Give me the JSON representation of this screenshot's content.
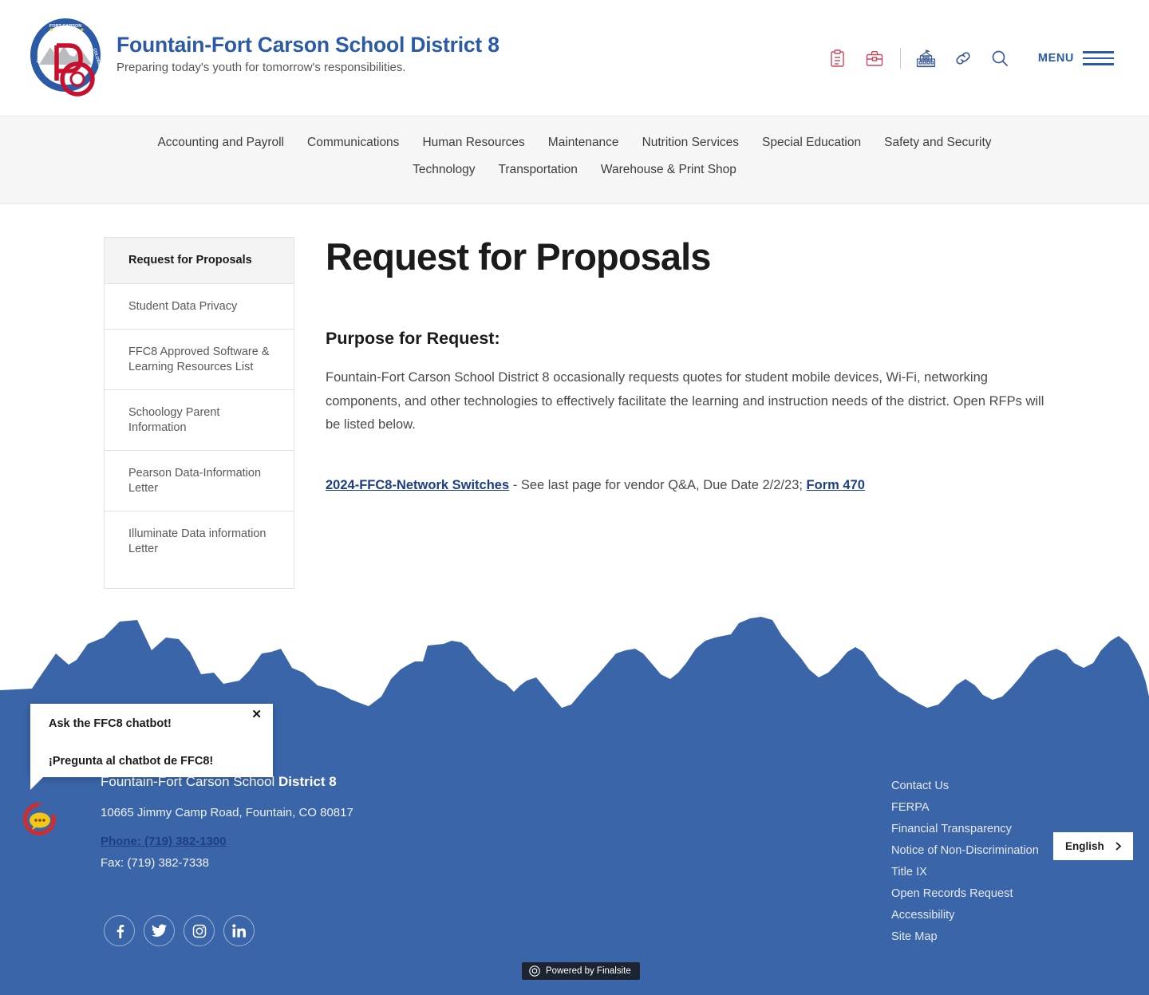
{
  "header": {
    "logo_alt": "district-seal-logo",
    "logo_ring_text": "FOUNTAIN • FORT CARSON • COLORADO",
    "logo_monogram": "D8",
    "title": "Fountain-Fort Carson School District 8",
    "tagline": "Preparing today's youth for tomorrow's responsibilities.",
    "tools": [
      {
        "name": "clipboard-icon",
        "color": "#c9485b"
      },
      {
        "name": "briefcase-icon",
        "color": "#c9485b"
      },
      {
        "name": "school-building-icon",
        "color": "#3b5998"
      },
      {
        "name": "link-icon",
        "color": "#3b5998"
      },
      {
        "name": "search-icon",
        "color": "#3b5998"
      }
    ],
    "menu_label": "MENU"
  },
  "subnav": {
    "items": [
      "Accounting and Payroll",
      "Communications",
      "Human Resources",
      "Maintenance",
      "Nutrition Services",
      "Special Education",
      "Safety and Security",
      "Technology",
      "Transportation",
      "Warehouse & Print Shop"
    ]
  },
  "sidebar": {
    "items": [
      {
        "label": "Request for Proposals",
        "active": true
      },
      {
        "label": "Student Data Privacy",
        "active": false
      },
      {
        "label": "FFC8 Approved Software & Learning Resources List",
        "active": false
      },
      {
        "label": "Schoology Parent Information",
        "active": false
      },
      {
        "label": "Pearson Data-Information Letter",
        "active": false
      },
      {
        "label": "Illuminate Data information Letter",
        "active": false
      }
    ]
  },
  "main": {
    "title": "Request for Proposals",
    "section_heading": "Purpose for Request:",
    "paragraph": "Fountain-Fort Carson School District 8 occasionally requests quotes for student mobile devices, Wi-Fi, networking components, and other technologies to effectively facilitate the learning and instruction needs of the district. Open RFPs will be listed below.",
    "rfp": {
      "link1": "2024-FFC8-Network Switches",
      "middle": " - See last page for vendor Q&A, Due Date 2/2/23; ",
      "link2": "Form 470"
    }
  },
  "chatbot": {
    "line_en": "Ask the FFC8 chatbot!",
    "line_es": "¡Pregunta al chatbot de FFC8!",
    "close_label": "✕",
    "launcher_name": "chatbot-launcher-icon"
  },
  "footer": {
    "district_thin": "Fountain-Fort Carson School ",
    "district_bold": "District 8",
    "address": "10665 Jimmy Camp Road, Fountain, CO  80817",
    "phone": "Phone: (719) 382-1300",
    "fax": "Fax: (719) 382-7338",
    "social": [
      {
        "name": "facebook-icon",
        "glyph": "f"
      },
      {
        "name": "twitter-icon",
        "glyph": "t"
      },
      {
        "name": "instagram-icon",
        "glyph": "i"
      },
      {
        "name": "linkedin-icon",
        "glyph": "in"
      }
    ],
    "links": [
      "Contact Us",
      "FERPA",
      "Financial Transparency",
      "Notice of Non-Discrimination",
      "Title IX",
      "Open Records Request",
      "Accessibility",
      "Site Map"
    ],
    "language": "English",
    "powered_by": "Powered by Finalsite",
    "background": "#3a65a8",
    "mountain_color": "#3a65a8"
  }
}
